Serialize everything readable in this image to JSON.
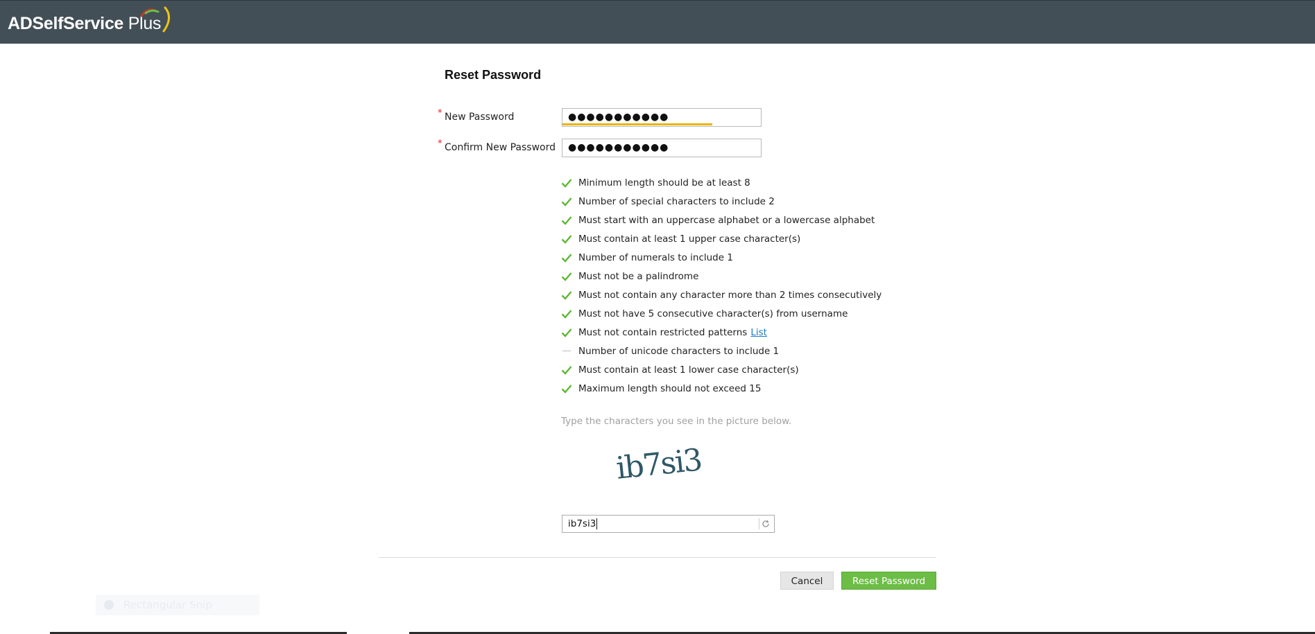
{
  "header": {
    "logo_text": "ADSelfService",
    "logo_plus": "Plus",
    "logo_colors": [
      "#c0392b",
      "#6cbd45",
      "#f1c40f"
    ]
  },
  "form": {
    "title": "Reset Password",
    "new_password": {
      "label": "New Password",
      "value": "●●●●●●●●●●●",
      "strength_fraction": 0.75
    },
    "confirm_password": {
      "label": "Confirm New Password",
      "value": "●●●●●●●●●●●"
    },
    "required_marker": "*"
  },
  "rules": [
    {
      "text": "Minimum length should be at least 8",
      "status": "check"
    },
    {
      "text": "Number of special characters to include 2",
      "status": "check"
    },
    {
      "text": "Must start with an uppercase alphabet or a lowercase alphabet",
      "status": "check"
    },
    {
      "text": "Must contain at least 1 upper case character(s)",
      "status": "check"
    },
    {
      "text": "Number of numerals to include 1",
      "status": "check"
    },
    {
      "text": "Must not be a palindrome",
      "status": "check"
    },
    {
      "text": "Must not contain any character more than 2 times consecutively",
      "status": "check"
    },
    {
      "text": "Must not have 5 consecutive character(s) from username",
      "status": "check"
    },
    {
      "text": "Must not contain restricted patterns",
      "status": "check",
      "link": "List"
    },
    {
      "text": "Number of unicode characters to include 1",
      "status": "pending"
    },
    {
      "text": "Must contain at least 1 lower case character(s)",
      "status": "check"
    },
    {
      "text": "Maximum length should not exceed 15",
      "status": "check"
    }
  ],
  "captcha": {
    "hint": "Type the characters you see in the picture below.",
    "image_text": "ib7si3",
    "input_value": "ib7si3"
  },
  "buttons": {
    "cancel": "Cancel",
    "reset": "Reset Password"
  },
  "colors": {
    "header_bg": "#434f57",
    "check": "#5cb832",
    "primary_button": "#6cbd45",
    "link": "#1a7bbf",
    "strength": "#e9b400"
  },
  "overlay": {
    "ghost_label": "Rectangular Snip"
  }
}
